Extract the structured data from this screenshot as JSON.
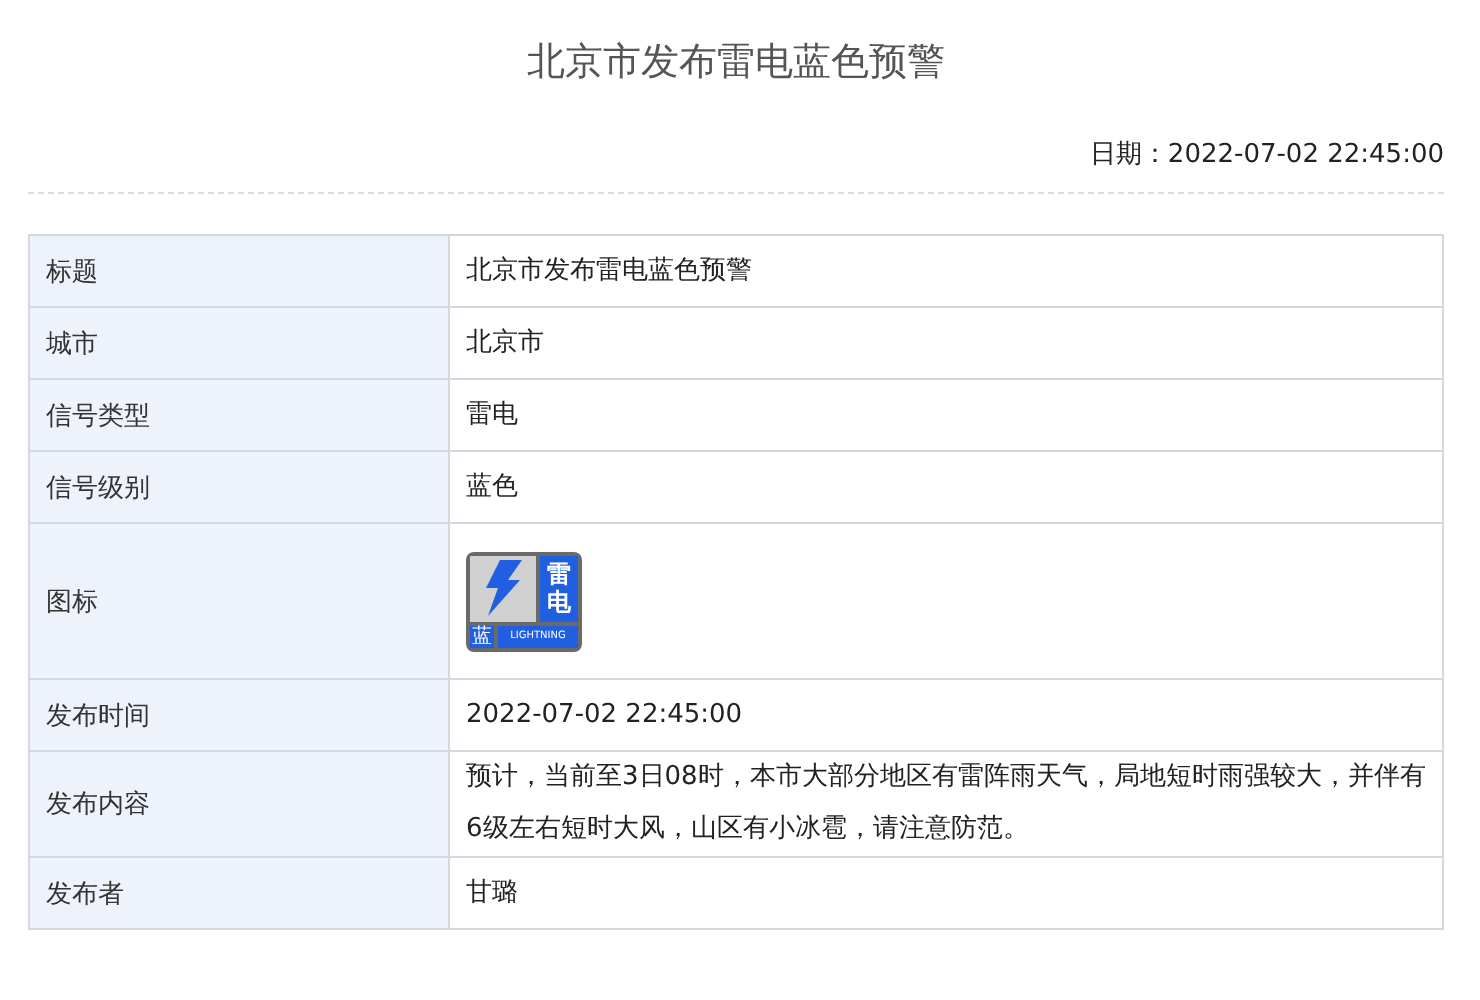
{
  "title": "北京市发布雷电蓝色预警",
  "date": "日期：2022-07-02 22:45:00",
  "rows": [
    {
      "kind": "text",
      "label": "标题",
      "value": "北京市发布雷电蓝色预警"
    },
    {
      "kind": "text",
      "label": "城市",
      "value": "北京市"
    },
    {
      "kind": "text",
      "label": "信号类型",
      "value": "雷电"
    },
    {
      "kind": "text",
      "label": "信号级别",
      "value": "蓝色"
    },
    {
      "kind": "icon",
      "label": "图标",
      "signal": "雷电",
      "level_text": "蓝",
      "english": "LIGHTNING"
    },
    {
      "kind": "text",
      "label": "发布时间",
      "value": "2022-07-02 22:45:00"
    },
    {
      "kind": "text",
      "label": "发布内容",
      "value": "预计，当前至3日08时，本市大部分地区有雷阵雨天气，局地短时雨强较大，并伴有6级左右短时大风，山区有小冰雹，请注意防范。"
    },
    {
      "kind": "text",
      "label": "发布者",
      "value": "甘璐"
    }
  ]
}
